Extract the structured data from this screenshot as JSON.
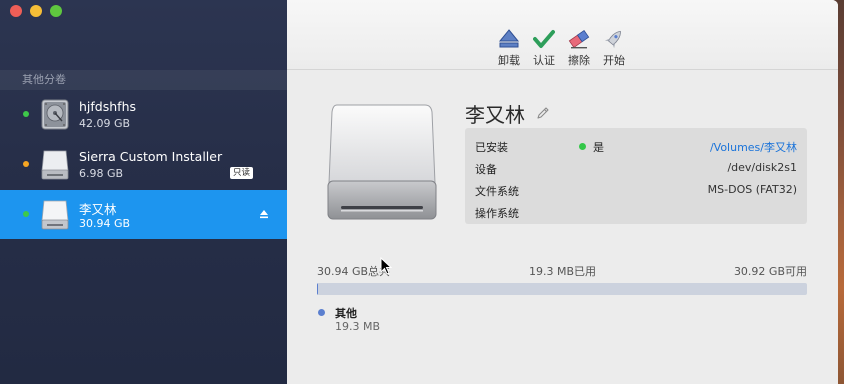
{
  "sidebar": {
    "section_header": "其他分卷",
    "disks": [
      {
        "name": "hjfdshfhs",
        "size": "42.09 GB",
        "status_color": "#3ec84a",
        "icon": "internal-disk-icon"
      },
      {
        "name": "Sierra Custom Installer",
        "size": "6.98 GB",
        "status_color": "#f5a623",
        "icon": "external-disk-icon",
        "badge": "只读"
      },
      {
        "name": "李又林",
        "size": "30.94 GB",
        "status_color": "#3ec84a",
        "icon": "external-disk-icon",
        "selected": true
      }
    ]
  },
  "toolbar": {
    "unmount_label": "卸载",
    "verify_label": "认证",
    "erase_label": "擦除",
    "start_label": "开始"
  },
  "volume": {
    "title": "李又林",
    "info": {
      "installed_label": "已安装",
      "installed_value": "是",
      "mount_path": "/Volumes/李又林",
      "device_label": "设备",
      "device_value": "/dev/disk2s1",
      "filesystem_label": "文件系统",
      "filesystem_value": "MS-DOS (FAT32)",
      "os_label": "操作系统"
    }
  },
  "usage": {
    "total": "30.94 GB总共",
    "used": "19.3 MB已用",
    "free": "30.92 GB可用",
    "used_fraction": 0.0006,
    "legend": [
      {
        "name": "其他",
        "size": "19.3 MB",
        "color": "#5b7fcf"
      }
    ]
  },
  "colors": {
    "selection": "#1d95ef",
    "link": "#1a73d9",
    "status_green": "#33c748"
  }
}
